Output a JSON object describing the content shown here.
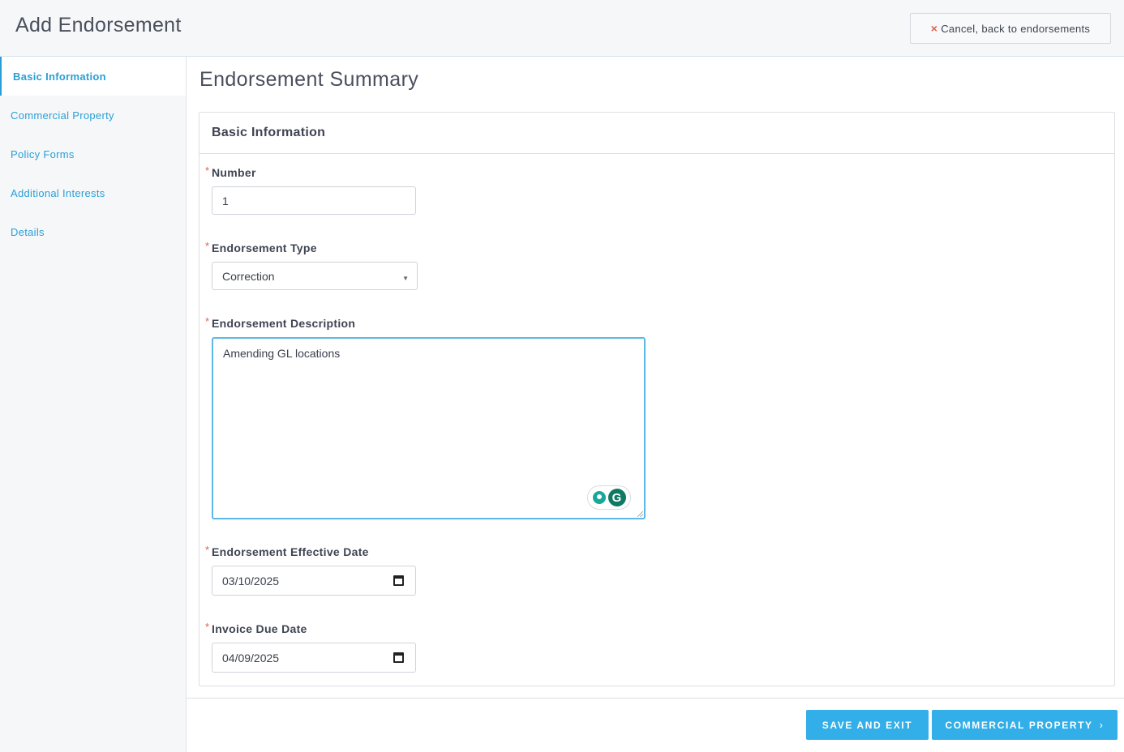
{
  "header": {
    "title": "Add Endorsement",
    "cancel_label": "Cancel, back to endorsements"
  },
  "sidebar": {
    "items": [
      {
        "label": "Basic Information",
        "active": true
      },
      {
        "label": "Commercial Property",
        "active": false
      },
      {
        "label": "Policy Forms",
        "active": false
      },
      {
        "label": "Additional Interests",
        "active": false
      },
      {
        "label": "Details",
        "active": false
      }
    ]
  },
  "main": {
    "section_title": "Endorsement Summary",
    "panel_title": "Basic Information",
    "required_marker": "*",
    "fields": {
      "number": {
        "label": "Number",
        "value": "1"
      },
      "type": {
        "label": "Endorsement Type",
        "value": "Correction"
      },
      "description": {
        "label": "Endorsement Description",
        "value": "Amending GL locations"
      },
      "effective_date": {
        "label": "Endorsement Effective Date",
        "value": "03/10/2025"
      },
      "invoice_due_date": {
        "label": "Invoice Due Date",
        "value": "04/09/2025"
      }
    },
    "grammarly_letter": "G"
  },
  "footer": {
    "save_label": "SAVE AND EXIT",
    "next_label": "COMMERCIAL PROPERTY"
  },
  "colors": {
    "accent": "#32aee8",
    "link": "#2a9fd6",
    "required": "#e0604f"
  }
}
